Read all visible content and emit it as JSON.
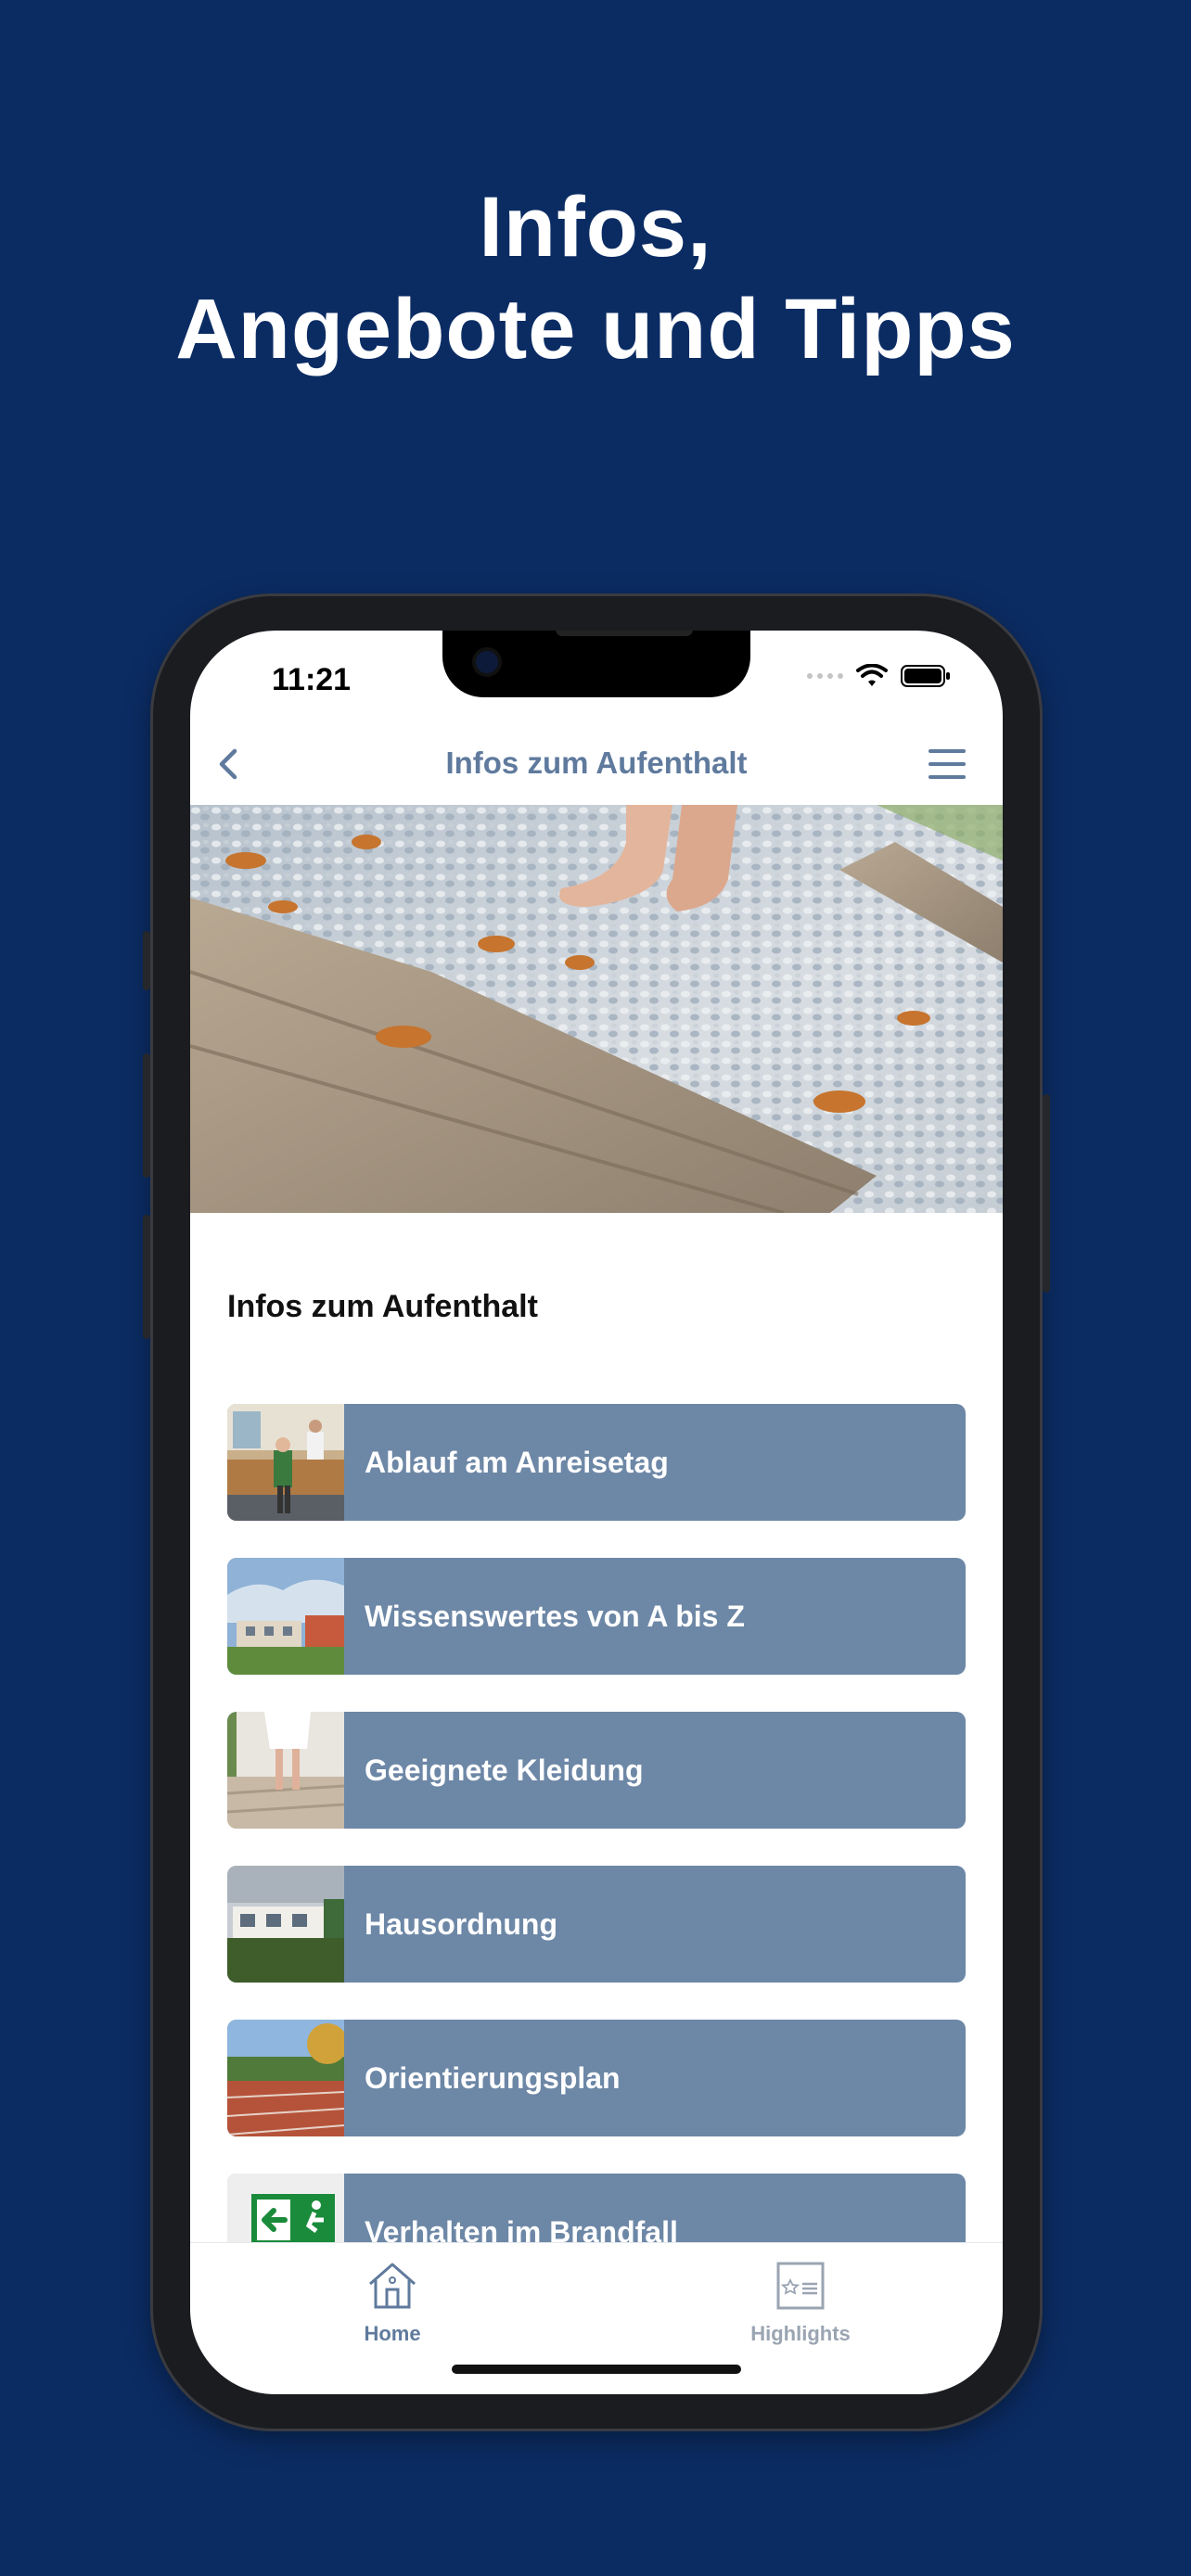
{
  "promo": {
    "line1": "Infos,",
    "line2": "Angebote und Tipps"
  },
  "status_bar": {
    "time": "11:21"
  },
  "nav": {
    "title": "Infos zum Aufenthalt"
  },
  "section": {
    "title": "Infos zum Aufenthalt"
  },
  "items": [
    {
      "label": "Ablauf am Anreisetag"
    },
    {
      "label": "Wissenswertes von A bis Z"
    },
    {
      "label": "Geeignete Kleidung"
    },
    {
      "label": "Hausordnung"
    },
    {
      "label": "Orientierungsplan"
    },
    {
      "label": "Verhalten im Brandfall"
    }
  ],
  "tabs": [
    {
      "label": "Home",
      "icon": "house-icon",
      "active": true
    },
    {
      "label": "Highlights",
      "icon": "highlights-icon",
      "active": false
    }
  ],
  "colors": {
    "background": "#0b2c63",
    "accent": "#5f7a9d",
    "list_item": "#6d87a6",
    "inactive_tab": "#9aa4b2"
  }
}
